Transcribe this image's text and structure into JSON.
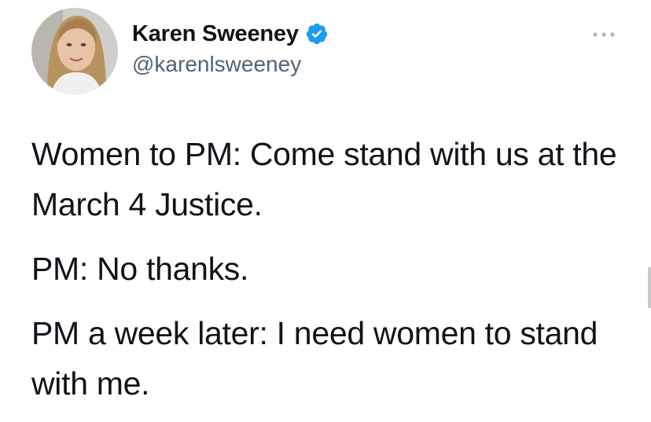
{
  "tweet": {
    "author": {
      "name": "Karen Sweeney",
      "handle": "@karenlsweeney",
      "verified": true
    },
    "paragraphs": [
      "Women to PM: Come stand with us at the March 4 Justice.",
      "PM: No thanks.",
      "PM a week later: I need women to stand with me."
    ]
  },
  "icons": {
    "verified": "verified-badge-icon",
    "more": "more-options-icon"
  },
  "colors": {
    "verified_blue": "#1d9bf0",
    "handle_gray": "#536471",
    "text": "#0f1419"
  }
}
